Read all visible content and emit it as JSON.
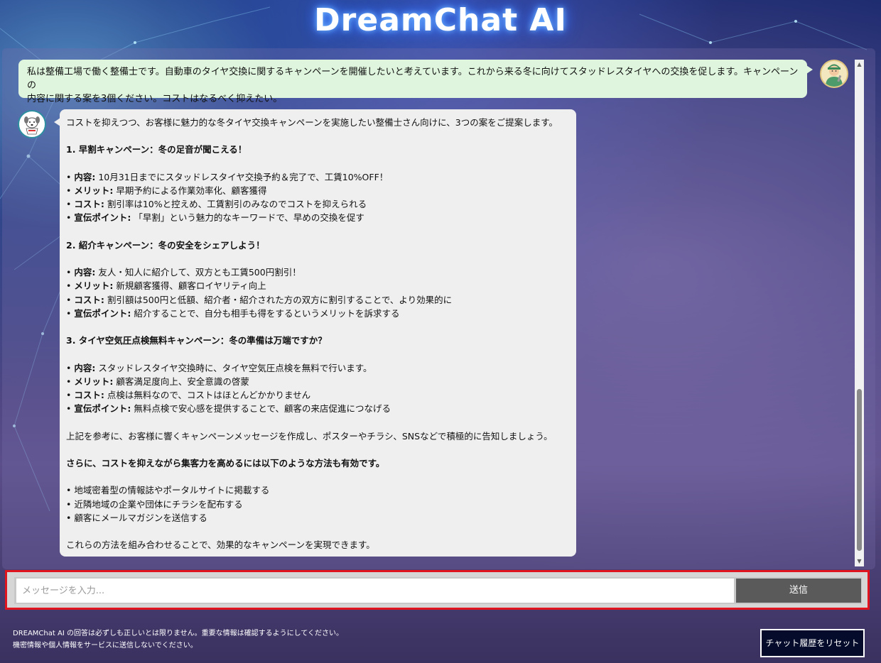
{
  "app": {
    "title": "DreamChat AI"
  },
  "messages": {
    "user_text_line1": "私は整備工場で働く整備士です。自動車のタイヤ交換に関するキャンペーンを開催したいと考えています。これから来る冬に向けてスタッドレスタイヤへの交換を促します。キャンペーンの",
    "user_text_line2": "内容に関する案を3個ください。コストはなるべく抑えたい。",
    "bot": {
      "intro": "コストを抑えつつ、お客様に魅力的な冬タイヤ交換キャンペーンを実施したい整備士さん向けに、3つの案をご提案します。",
      "plans": [
        {
          "heading": "1. 早割キャンペーン：冬の足音が聞こえる！",
          "items": [
            {
              "label": "内容:",
              "text": " 10月31日までにスタッドレスタイヤ交換予約＆完了で、工賃10%OFF！"
            },
            {
              "label": "メリット:",
              "text": " 早期予約による作業効率化、顧客獲得"
            },
            {
              "label": "コスト:",
              "text": " 割引率は10%と控えめ、工賃割引のみなのでコストを抑えられる"
            },
            {
              "label": "宣伝ポイント:",
              "text": " 「早割」という魅力的なキーワードで、早めの交換を促す"
            }
          ]
        },
        {
          "heading": "2. 紹介キャンペーン：冬の安全をシェアしよう！",
          "items": [
            {
              "label": "内容:",
              "text": " 友人・知人に紹介して、双方とも工賃500円割引！"
            },
            {
              "label": "メリット:",
              "text": " 新規顧客獲得、顧客ロイヤリティ向上"
            },
            {
              "label": "コスト:",
              "text": " 割引額は500円と低額、紹介者・紹介された方の双方に割引することで、より効果的に"
            },
            {
              "label": "宣伝ポイント:",
              "text": " 紹介することで、自分も相手も得をするというメリットを訴求する"
            }
          ]
        },
        {
          "heading": "3. タイヤ空気圧点検無料キャンペーン：冬の準備は万端ですか？",
          "items": [
            {
              "label": "内容:",
              "text": " スタッドレスタイヤ交換時に、タイヤ空気圧点検を無料で行います。"
            },
            {
              "label": "メリット:",
              "text": " 顧客満足度向上、安全意識の啓蒙"
            },
            {
              "label": "コスト:",
              "text": " 点検は無料なので、コストはほとんどかかりません"
            },
            {
              "label": "宣伝ポイント:",
              "text": " 無料点検で安心感を提供することで、顧客の来店促進につなげる"
            }
          ]
        }
      ],
      "summary": "上記を参考に、お客様に響くキャンペーンメッセージを作成し、ポスターやチラシ、SNSなどで積極的に告知しましょう。",
      "extra_heading": "さらに、コストを抑えながら集客力を高めるには以下のような方法も有効です。",
      "extra_items": [
        "• 地域密着型の情報誌やポータルサイトに掲載する",
        "• 近隣地域の企業や団体にチラシを配布する",
        "• 顧客にメールマガジンを送信する"
      ],
      "closing": "これらの方法を組み合わせることで、効果的なキャンペーンを実現できます。"
    }
  },
  "input": {
    "placeholder": "メッセージを入力...",
    "value": "",
    "send_label": "送信"
  },
  "footer": {
    "disclaimer_line1": "DREAMChat AI の回答は必ずしも正しいとは限りません。重要な情報は確認するようにしてください。",
    "disclaimer_line2": "機密情報や個人情報をサービスに送信しないでください。",
    "reset_label": "チャット履歴をリセット"
  },
  "colors": {
    "accent_highlight": "#e0141e",
    "user_bubble": "#dff5dd",
    "bot_bubble": "#efefef",
    "send_button": "#5a5a5a"
  },
  "icons": {
    "user_avatar": "mechanic-avatar-icon",
    "bot_avatar": "dog-mascot-avatar-icon",
    "scroll_up": "scroll-up-arrow-icon",
    "scroll_down": "scroll-down-arrow-icon"
  }
}
